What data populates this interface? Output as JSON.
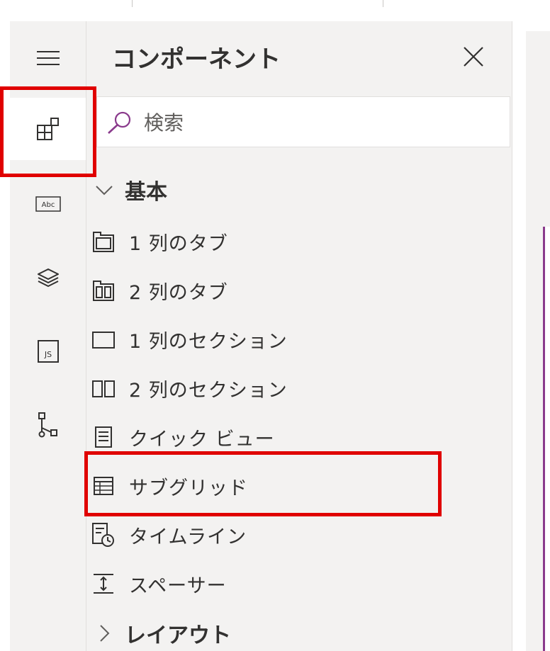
{
  "panel": {
    "title": "コンポーネント",
    "search_placeholder": "検索"
  },
  "rail": {
    "items": [
      {
        "icon": "hamburger-menu-icon",
        "active": false
      },
      {
        "icon": "components-icon",
        "active": true
      },
      {
        "icon": "text-field-icon",
        "label": "Abc",
        "active": false
      },
      {
        "icon": "layers-icon",
        "active": false
      },
      {
        "icon": "javascript-icon",
        "label": "JS",
        "active": false
      },
      {
        "icon": "business-rules-icon",
        "active": false
      }
    ]
  },
  "groups": [
    {
      "label": "基本",
      "expanded": true,
      "items": [
        {
          "label": "1 列のタブ",
          "icon": "one-column-tab-icon"
        },
        {
          "label": "2 列のタブ",
          "icon": "two-column-tab-icon"
        },
        {
          "label": "1 列のセクション",
          "icon": "one-column-section-icon"
        },
        {
          "label": "2 列のセクション",
          "icon": "two-column-section-icon"
        },
        {
          "label": "クイック ビュー",
          "icon": "quick-view-icon"
        },
        {
          "label": "サブグリッド",
          "icon": "subgrid-icon",
          "highlighted": true
        },
        {
          "label": "タイムライン",
          "icon": "timeline-icon"
        },
        {
          "label": "スペーサー",
          "icon": "spacer-icon"
        }
      ]
    },
    {
      "label": "レイアウト",
      "expanded": false
    }
  ],
  "colors": {
    "highlight": "#e00000",
    "search_accent": "#8a3a8c",
    "panel_bg": "#f3f2f1"
  }
}
